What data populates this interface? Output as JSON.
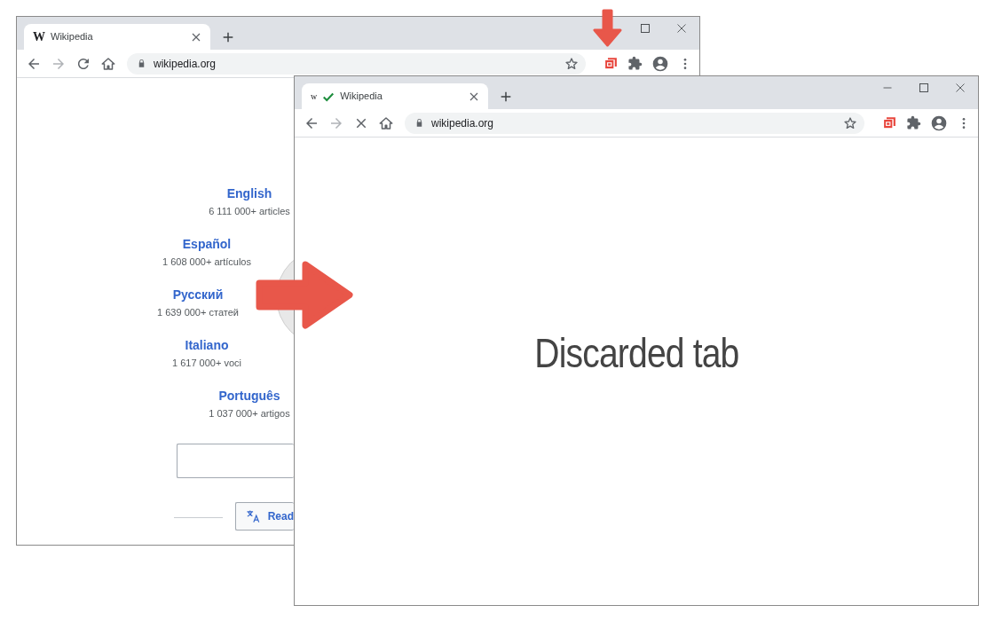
{
  "back_window": {
    "tab": {
      "favicon": "W",
      "title": "Wikipedia",
      "selected": true
    },
    "url": "wikipedia.org",
    "loading": false,
    "languages": [
      {
        "name": "English",
        "count": "6 111 000+ articles"
      },
      {
        "name": "Español",
        "count": "1 608 000+ artículos"
      },
      {
        "name": "Русский",
        "count": "1 639 000+ статей"
      },
      {
        "name": "Italiano",
        "count": "1 617 000+ voci"
      },
      {
        "name": "Português",
        "count": "1 037 000+ artigos"
      }
    ],
    "read_button": "Read"
  },
  "front_window": {
    "tab": {
      "favicon": "w",
      "title": "Wikipedia",
      "selected": true,
      "discarded": true
    },
    "url": "wikipedia.org",
    "loading": true,
    "message": "Discarded tab"
  }
}
